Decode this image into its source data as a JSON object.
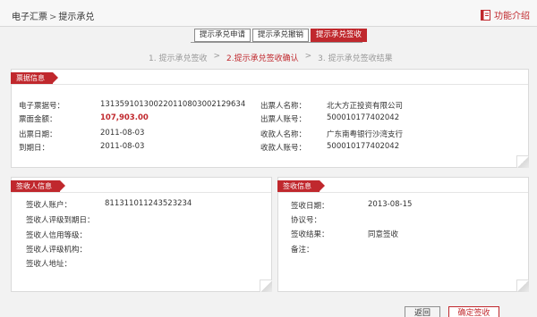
{
  "header": {
    "crumb_1": "电子汇票",
    "crumb_sep": ">",
    "crumb_2": "提示承兑",
    "intro_link": "功能介绍"
  },
  "tabs": [
    {
      "label": "提示承兑申请"
    },
    {
      "label": "提示承兑撤销"
    },
    {
      "label": "提示承兑签收"
    }
  ],
  "steps": {
    "step1": "1. 提示承兑签收",
    "arrow1": ">",
    "step2": "2.提示承兑签收确认",
    "arrow2": ">",
    "step3": "3. 提示承兑签收结果"
  },
  "bill_info": {
    "title": "票据信息",
    "bill_no_label": "电子票据号：",
    "bill_no": "131359101300220110803002129634",
    "amount_label": "票面金额：",
    "amount": "107,903.00",
    "issue_date_label": "出票日期：",
    "issue_date": "2011-08-03",
    "due_date_label": "到期日：",
    "due_date": "2011-08-03",
    "drawer_name_label": "出票人名称：",
    "drawer_name": "北大方正投资有限公司",
    "drawer_acct_label": "出票人账号：",
    "drawer_acct": "500010177402042",
    "payee_name_label": "收款人名称：",
    "payee_name": "广东南粤银行沙湾支行",
    "payee_acct_label": "收款人账号：",
    "payee_acct": "500010177402042"
  },
  "signer_info": {
    "title": "签收人信息",
    "account_label": "签收人账户：",
    "account": "811311011243523234",
    "rating_due_label": "签收人评级到期日：",
    "credit_level_label": "签收人信用等级：",
    "rating_org_label": "签收人评级机构：",
    "address_label": "签收人地址："
  },
  "sign_info": {
    "title": "签收信息",
    "date_label": "签收日期：",
    "date": "2013-08-15",
    "agreement_label": "协议号：",
    "result_label": "签收结果：",
    "result": "同意签收",
    "remark_label": "备注："
  },
  "buttons": {
    "back": "返回",
    "confirm": "确定签收"
  }
}
